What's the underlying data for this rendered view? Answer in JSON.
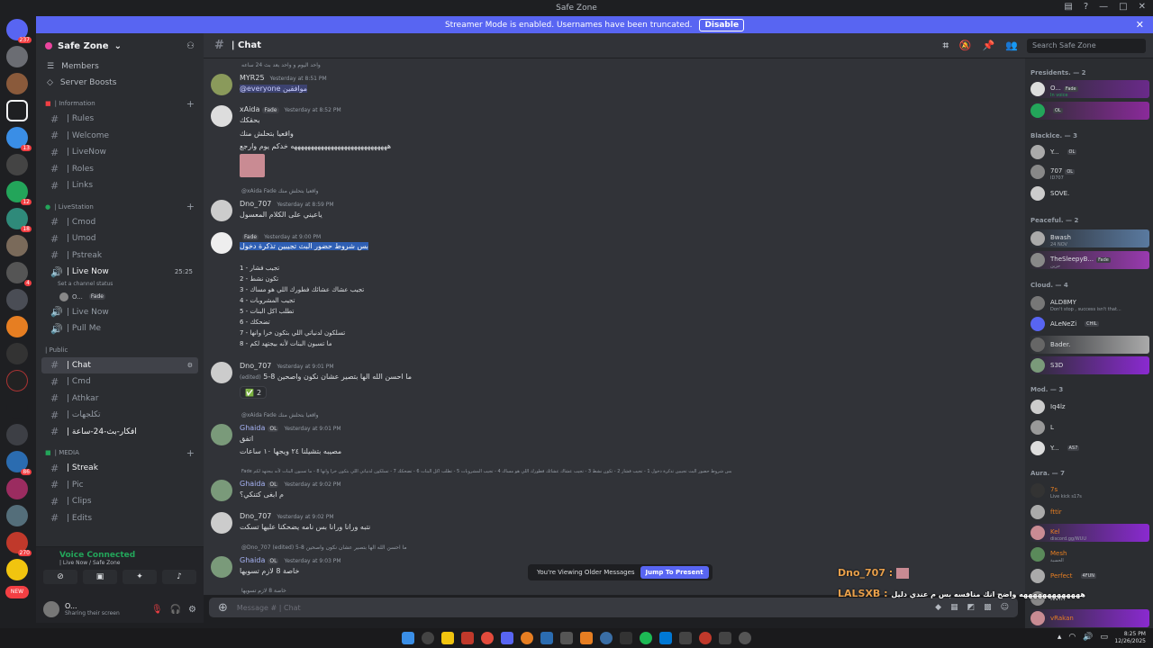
{
  "window": {
    "title": "Safe Zone"
  },
  "banner": {
    "text": "Streamer Mode is enabled. Usernames have been truncated.",
    "button": "Disable"
  },
  "server": {
    "name": "Safe Zone"
  },
  "nav": {
    "members": "Members",
    "boosts": "Server Boosts"
  },
  "categories": {
    "information": "| Information",
    "livestation": "| LiveStation",
    "public": "| Public",
    "media": "| MEDIA"
  },
  "channels": {
    "rules": "| Rules",
    "welcome": "| Welcome",
    "livenow": "| LiveNow",
    "roles": "| Roles",
    "links": "| Links",
    "cmod": "| Cmod",
    "umod": "| Umod",
    "pstreak": "| Pstreak",
    "livenow_voice": "| Live Now",
    "livenow_count": "25:25",
    "channel_status": "Set a channel status",
    "voice_user": "O...",
    "voice_user_tag": "Fade",
    "livenow2": "| Live Now",
    "pullme": "| Pull Me",
    "chat": "| Chat",
    "cmd": "| Cmd",
    "athkar": "| Athkar",
    "takjihat": "| تكلجهات",
    "afkar": "| افكار-بث-24-ساعة",
    "streak": "| Streak",
    "pic": "| Pic",
    "clips": "| Clips",
    "edits": "| Edits"
  },
  "voice": {
    "title": "Voice Connected",
    "sub": "| Live Now / Safe Zone"
  },
  "user": {
    "name": "O...",
    "status": "Sharing their screen"
  },
  "header": {
    "channel": "| Chat",
    "search": "Search Safe Zone"
  },
  "messages": {
    "m0_reply": "واحد اليوم و واحد بعد بث 24 ساعه",
    "m1_name": "MYR25",
    "m1_ts": "Yesterday at 8:51 PM",
    "m1_text": "@everyone  موافقين",
    "m2_name": "xAida",
    "m2_tag": "Fade",
    "m2_ts": "Yesterday at 8:52 PM",
    "m2_l1": "بحقكك",
    "m2_l2": "واقعيا بتحلش منك",
    "m2_l3": "هههههههههههههههههههههههههههههه خدكم يوم وارجع",
    "m3_reply": "@xAida  Fade  واقعيا بتحلش منك",
    "m3_name": "Dno_707",
    "m3_ts": "Yesterday at 8:59 PM",
    "m3_text": "ياعيني على الكلام المعسول",
    "m4_tag": "Fade",
    "m4_ts": "Yesterday at 9:00 PM",
    "m4_text": "بس شروط حضور البث تجيبين تذكرة دخول",
    "list": [
      "1 - تجيب فشار",
      "2 - تكون نشط",
      "3 - تجيب عشاك عشائك فطورك اللي هو مساك",
      "4 - تجيب المشروبات",
      "5 - تطلب اكل البنات",
      "6 - تضحكك",
      "7 - تسلكون لدنياتي اللي بتكون خرا وانها",
      "8 - ما تسبون البنات لأنه بيجتهد لكم"
    ],
    "m5_name": "Dno_707",
    "m5_ts": "Yesterday at 9:01 PM",
    "m5_text": "5-8 ما احسن الله الها بتصير عشان نكون واصحين",
    "m5_edited": "(edited)",
    "m5_react_count": "2",
    "m6_reply": "@xAida  Fade  واقعيا بتحلش منك",
    "m6_name": "Ghaida",
    "m6_tag": "OL",
    "m6_ts": "Yesterday at 9:01 PM",
    "m6_l1": "اتفق",
    "m6_l2": "مصيبه بتشيلنا ٢٤ ويجها ١٠ ساعات",
    "m7_reply": "Fade  بس شروط حضور البث تجيبين تذكرة دخول 1 - تجيب فشار 2 - تكون نشط 3 - تجيب عشاك عشائك فطورك اللي هو مساك 4 - تجيب المشروبات 5 - تطلب اكل البنات 6 - تضحكك 7 - تسلكون لدنياتي اللي بتكون خرا وانها 8 - ما تسبون البنات لأنه بيجتهد لكم",
    "m7_name": "Ghaida",
    "m7_tag": "OL",
    "m7_ts": "Yesterday at 9:02 PM",
    "m7_text": "م ابغى كتنكي؟",
    "m8_name": "Dno_707",
    "m8_ts": "Yesterday at 9:02 PM",
    "m8_text": "نتبه ورانا ورانا بس نامه يضحكنا عليها تسكت",
    "m9_reply": "@Dno_707  (edited)  5-8 ما احسن الله الها بتصير عشان نكون واصحين",
    "m9_name": "Ghaida",
    "m9_tag": "OL",
    "m9_ts": "Yesterday at 9:03 PM",
    "m9_text": "خاصة 8 لازم تسويها",
    "m10_reply": "خاصة 8 لازم تسويها"
  },
  "older": {
    "text": "You're Viewing Older Messages",
    "jump": "Jump To Present"
  },
  "input": {
    "placeholder": "Message #  | Chat"
  },
  "member_groups": {
    "presidents": "Presidents. — 2",
    "blacklce": "Blacklce. — 3",
    "peaceful": "Peaceful. — 2",
    "cloud": "Cloud. — 4",
    "mod": "Mod. — 3",
    "aura": "Aura. — 7"
  },
  "members": {
    "p1": "O...",
    "p1_tag": "Fade",
    "p1_sub": "In voice",
    "p2_tag": "OL",
    "b1": "Y...",
    "b1_tag": "OL",
    "b2": "707",
    "b2_tag": "OL",
    "b2_sub": "ID707",
    "b3": "SOVE.",
    "pe1": "Bwash",
    "pe1_sub": "24 NOV",
    "pe2": "TheSleepyB...",
    "pe2_tag": "Fade",
    "pe2_sub": "حزين",
    "c1": "ALD8MY",
    "c1_sub": "Don't stop , success isn't that...",
    "c2": "ALeNeZi",
    "c2_tag": "CHIL",
    "c3": "Bader.",
    "c4": "S3D",
    "mo1": "Iq4lz",
    "mo2": "L",
    "mo3": "Y...",
    "mo3_tag": "AS7",
    "a1": "7s",
    "a1_sub": "Live kick s17s",
    "a2": "fttir",
    "a3": "Kel",
    "a3_sub": "discord.gg/WUU",
    "a4": "Mesh",
    "a4_sub": "الحسبة",
    "a5": "Perfect",
    "a5_tag": "4FUN",
    "a6": "Nvm",
    "a7": "vRakan"
  },
  "overlay": {
    "line1_user": "Dno_707 :",
    "line2_user": "LALSXB :",
    "line2_text": "هههههههههههههه واضح انك منافسه بس م عندي دليل"
  },
  "tray": {
    "time": "8:25 PM",
    "date": "12/26/2025"
  },
  "server_badges": [
    "237",
    "13",
    "12",
    "18",
    "4",
    "86",
    "270",
    "NEW"
  ]
}
